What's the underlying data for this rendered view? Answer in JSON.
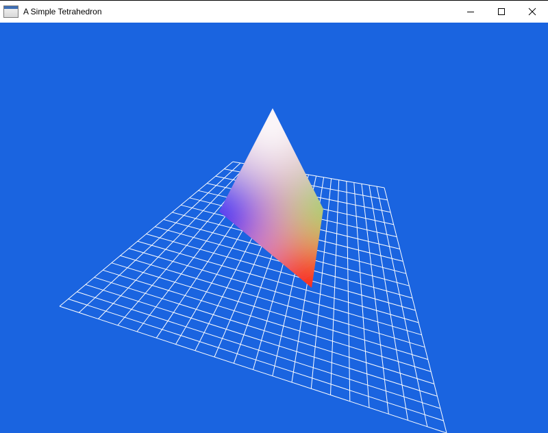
{
  "window": {
    "title": "A Simple Tetrahedron",
    "controls": {
      "minimize_icon": "minimize-icon",
      "maximize_icon": "maximize-icon",
      "close_icon": "close-icon"
    }
  },
  "scene": {
    "background_color": "#1A64E0",
    "grid_color": "#FFFFFF",
    "tetrahedron_vertex_colors": [
      "#FFFFFF",
      "#0000FF",
      "#00FF00",
      "#FF0000"
    ]
  }
}
